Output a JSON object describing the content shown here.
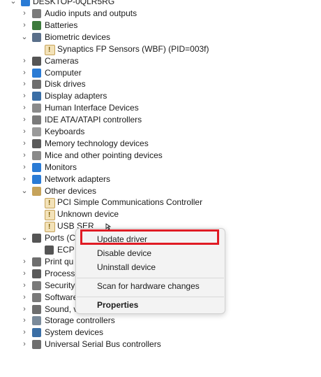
{
  "tree": {
    "root": "DESKTOP-0QLR5RG",
    "items": [
      {
        "label": "Audio inputs and outputs",
        "chev": "›",
        "icon": "speaker-icon",
        "color": "#7a7a7a"
      },
      {
        "label": "Batteries",
        "chev": "›",
        "icon": "battery-icon",
        "color": "#3c7a3c"
      },
      {
        "label": "Biometric devices",
        "chev": "⌄",
        "icon": "fingerprint-icon",
        "color": "#5a6f8a"
      },
      {
        "label": "Synaptics FP Sensors (WBF) (PID=003f)",
        "chev": "",
        "icon": "warning-device-icon",
        "color": "#c6a35a"
      },
      {
        "label": "Cameras",
        "chev": "›",
        "icon": "camera-icon",
        "color": "#555555"
      },
      {
        "label": "Computer",
        "chev": "›",
        "icon": "computer-icon",
        "color": "#2a7bd5"
      },
      {
        "label": "Disk drives",
        "chev": "›",
        "icon": "disk-icon",
        "color": "#6e6e6e"
      },
      {
        "label": "Display adapters",
        "chev": "›",
        "icon": "display-adapter-icon",
        "color": "#3a6ea5"
      },
      {
        "label": "Human Interface Devices",
        "chev": "›",
        "icon": "hid-icon",
        "color": "#8a8a8a"
      },
      {
        "label": "IDE ATA/ATAPI controllers",
        "chev": "›",
        "icon": "ide-icon",
        "color": "#7a7a7a"
      },
      {
        "label": "Keyboards",
        "chev": "›",
        "icon": "keyboard-icon",
        "color": "#9a9a9a"
      },
      {
        "label": "Memory technology devices",
        "chev": "›",
        "icon": "memory-icon",
        "color": "#5a5a5a"
      },
      {
        "label": "Mice and other pointing devices",
        "chev": "›",
        "icon": "mouse-icon",
        "color": "#8a8a8a"
      },
      {
        "label": "Monitors",
        "chev": "›",
        "icon": "monitor-icon",
        "color": "#2a7bd5"
      },
      {
        "label": "Network adapters",
        "chev": "›",
        "icon": "network-icon",
        "color": "#2a7bd5"
      },
      {
        "label": "Other devices",
        "chev": "⌄",
        "icon": "other-devices-icon",
        "color": "#c6a35a"
      },
      {
        "label": "PCI Simple Communications Controller",
        "chev": "",
        "icon": "warning-device-icon",
        "color": "#c6a35a"
      },
      {
        "label": "Unknown device",
        "chev": "",
        "icon": "warning-device-icon",
        "color": "#c6a35a"
      },
      {
        "label": "USB SER",
        "chev": "",
        "icon": "warning-device-icon",
        "color": "#c6a35a"
      },
      {
        "label": "Ports (C",
        "chev": "⌄",
        "icon": "port-icon",
        "color": "#555555"
      },
      {
        "label": "ECP",
        "chev": "",
        "icon": "port-icon",
        "color": "#555555"
      },
      {
        "label": "Print qu",
        "chev": "›",
        "icon": "printer-icon",
        "color": "#6e6e6e"
      },
      {
        "label": "Processo",
        "chev": "›",
        "icon": "processor-icon",
        "color": "#5a5a5a"
      },
      {
        "label": "Security",
        "chev": "›",
        "icon": "security-icon",
        "color": "#7a7a7a"
      },
      {
        "label": "Software",
        "chev": "›",
        "icon": "software-icon",
        "color": "#7a7a7a"
      },
      {
        "label": "Sound, v",
        "chev": "›",
        "icon": "sound-icon",
        "color": "#6e6e6e"
      },
      {
        "label": "Storage controllers",
        "chev": "›",
        "icon": "storage-icon",
        "color": "#7a8a9a"
      },
      {
        "label": "System devices",
        "chev": "›",
        "icon": "system-icon",
        "color": "#3a6ea5"
      },
      {
        "label": "Universal Serial Bus controllers",
        "chev": "›",
        "icon": "usb-icon",
        "color": "#6e6e6e"
      }
    ]
  },
  "context_menu": {
    "update": "Update driver",
    "disable": "Disable device",
    "uninstall": "Uninstall device",
    "scan": "Scan for hardware changes",
    "properties": "Properties"
  }
}
